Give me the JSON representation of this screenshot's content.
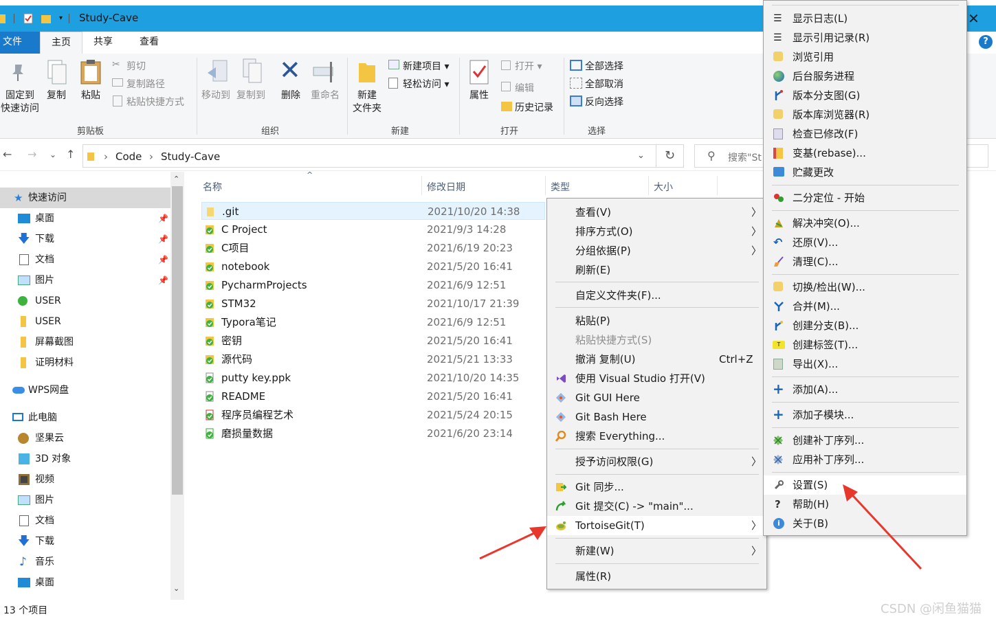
{
  "window": {
    "title": "Study-Cave",
    "close": "✕"
  },
  "tabs": {
    "file": "文件",
    "home": "主页",
    "share": "共享",
    "view": "查看"
  },
  "ribbon": {
    "clipboard": {
      "label": "剪贴板",
      "pin_line1": "固定到",
      "pin_line2": "快速访问",
      "copy": "复制",
      "paste": "粘贴",
      "cut": "剪切",
      "copy_path": "复制路径",
      "paste_shortcut": "粘贴快捷方式"
    },
    "organize": {
      "label": "组织",
      "move_to": "移动到",
      "copy_to": "复制到",
      "delete": "删除",
      "rename": "重命名"
    },
    "new": {
      "label": "新建",
      "new_folder_line1": "新建",
      "new_folder_line2": "文件夹",
      "new_item": "新建项目 ▾",
      "easy_access": "轻松访问 ▾"
    },
    "open": {
      "label": "打开",
      "properties": "属性",
      "open": "打开 ▾",
      "edit": "编辑",
      "history": "历史记录"
    },
    "select": {
      "label": "选择",
      "select_all": "全部选择",
      "select_none": "全部取消",
      "invert": "反向选择"
    }
  },
  "address": {
    "parts": [
      "Code",
      "Study-Cave"
    ],
    "search_placeholder": "搜索\"St"
  },
  "nav": {
    "items": [
      {
        "label": "快速访问",
        "icon": "star-icon"
      },
      {
        "label": "桌面",
        "icon": "desktop-icon"
      },
      {
        "label": "下载",
        "icon": "download-icon"
      },
      {
        "label": "文档",
        "icon": "document-icon"
      },
      {
        "label": "图片",
        "icon": "pictures-icon"
      },
      {
        "label": "USER",
        "icon": "git-folder-icon"
      },
      {
        "label": "USER",
        "icon": "folder-icon"
      },
      {
        "label": "屏幕截图",
        "icon": "folder-icon"
      },
      {
        "label": "证明材料",
        "icon": "folder-icon"
      },
      {
        "label": "WPS网盘",
        "icon": "cloud-icon"
      },
      {
        "label": "此电脑",
        "icon": "computer-icon"
      },
      {
        "label": "坚果云",
        "icon": "nutstore-icon"
      },
      {
        "label": "3D 对象",
        "icon": "3d-objects-icon"
      },
      {
        "label": "视频",
        "icon": "video-icon"
      },
      {
        "label": "图片",
        "icon": "pictures-icon"
      },
      {
        "label": "文档",
        "icon": "document-icon"
      },
      {
        "label": "下载",
        "icon": "download-icon"
      },
      {
        "label": "音乐",
        "icon": "music-icon"
      },
      {
        "label": "桌面",
        "icon": "desktop-icon"
      }
    ]
  },
  "columns": {
    "name": "名称",
    "date": "修改日期",
    "type": "类型",
    "size": "大小"
  },
  "files": [
    {
      "name": ".git",
      "date": "2021/10/20 14:38"
    },
    {
      "name": "C Project",
      "date": "2021/9/3 14:28"
    },
    {
      "name": "C项目",
      "date": "2021/6/19 20:23"
    },
    {
      "name": "notebook",
      "date": "2021/5/20 16:41"
    },
    {
      "name": "PycharmProjects",
      "date": "2021/6/9 12:51"
    },
    {
      "name": "STM32",
      "date": "2021/10/17 21:39"
    },
    {
      "name": "Typora笔记",
      "date": "2021/6/9 12:51"
    },
    {
      "name": "密钥",
      "date": "2021/5/20 16:41"
    },
    {
      "name": "源代码",
      "date": "2021/5/21 13:33"
    },
    {
      "name": "putty key.ppk",
      "date": "2021/10/20 14:35"
    },
    {
      "name": "README",
      "date": "2021/5/20 16:41"
    },
    {
      "name": "程序员编程艺术",
      "date": "2021/5/24 20:15"
    },
    {
      "name": "磨损量数据",
      "date": "2021/6/20 23:14"
    }
  ],
  "status": {
    "count": "13 个项目"
  },
  "context_menu": {
    "view": "查看(V)",
    "sort": "排序方式(O)",
    "group": "分组依据(P)",
    "refresh": "刷新(E)",
    "customize": "自定义文件夹(F)...",
    "paste": "粘贴(P)",
    "paste_shortcut": "粘贴快捷方式(S)",
    "undo": "撤消 复制(U)",
    "undo_shortcut": "Ctrl+Z",
    "vs": "使用 Visual Studio 打开(V)",
    "git_gui": "Git GUI Here",
    "git_bash": "Git Bash Here",
    "everything": "搜索 Everything...",
    "grant": "授予访问权限(G)",
    "git_sync": "Git 同步...",
    "git_commit": "Git 提交(C) -> \"main\"...",
    "tortoise": "TortoiseGit(T)",
    "new": "新建(W)",
    "properties": "属性(R)"
  },
  "tortoise_menu": {
    "items": [
      "显示日志(L)",
      "显示引用记录(R)",
      "浏览引用",
      "后台服务进程",
      "版本分支图(G)",
      "版本库浏览器(R)",
      "检查已修改(F)",
      "变基(rebase)...",
      "贮藏更改",
      "二分定位 - 开始",
      "解决冲突(O)...",
      "还原(V)...",
      "清理(C)...",
      "切换/检出(W)...",
      "合并(M)...",
      "创建分支(B)...",
      "创建标签(T)...",
      "导出(X)...",
      "添加(A)...",
      "添加子模块...",
      "创建补丁序列...",
      "应用补丁序列...",
      "设置(S)",
      "帮助(H)",
      "关于(B)"
    ]
  },
  "watermark": "CSDN @闲鱼猫猫",
  "colors": {
    "titlebar": "#1ea0e0",
    "file_tab": "#1979ca",
    "arrow": "#e8372b"
  }
}
